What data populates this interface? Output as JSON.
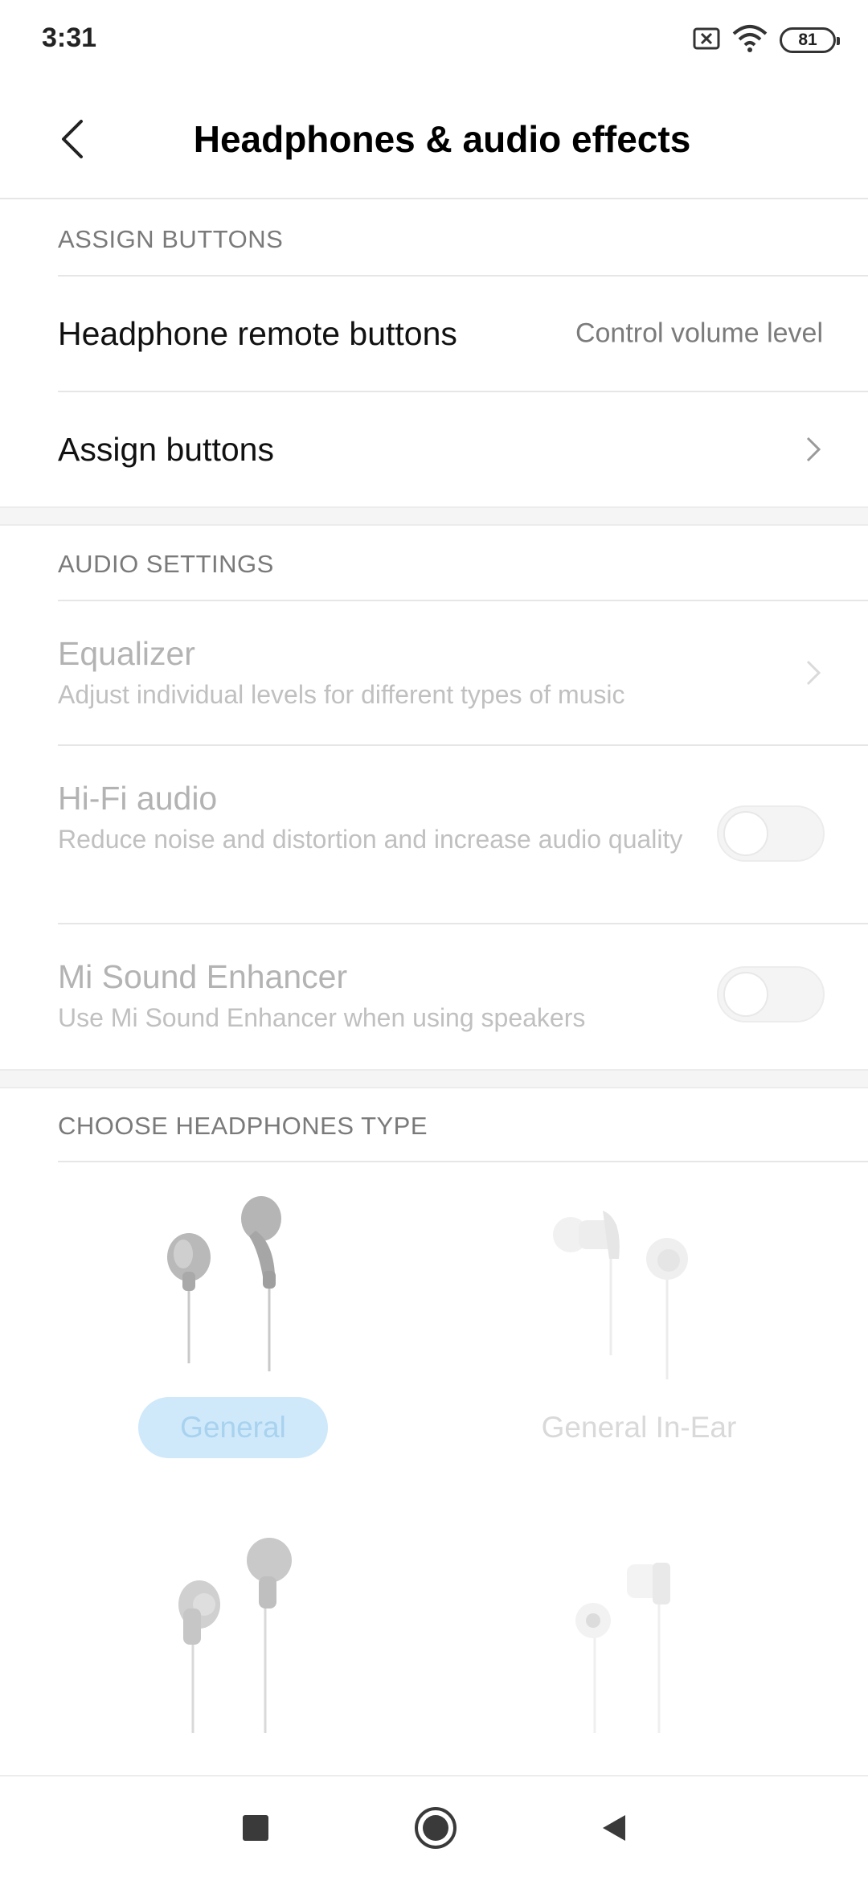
{
  "status_bar": {
    "time": "3:31",
    "battery": "81",
    "icons": [
      "sim-error-icon",
      "wifi-icon",
      "battery-icon"
    ]
  },
  "header": {
    "title": "Headphones & audio effects",
    "back_icon": "back-arrow-icon"
  },
  "assign_buttons_section": {
    "header": "ASSIGN BUTTONS",
    "items": [
      {
        "title": "Headphone remote buttons",
        "value": "Control volume level"
      },
      {
        "title": "Assign buttons",
        "icon": "chevron-right-icon"
      }
    ]
  },
  "audio_settings_section": {
    "header": "AUDIO SETTINGS",
    "items": [
      {
        "title": "Equalizer",
        "subtitle": "Adjust individual levels for different types of music",
        "enabled": false
      },
      {
        "title": "Hi-Fi audio",
        "subtitle": "Reduce noise and distortion and increase audio quality",
        "toggle": false,
        "enabled": false
      },
      {
        "title": "Mi Sound Enhancer",
        "subtitle": "Use Mi Sound Enhancer when using speakers",
        "toggle": false,
        "enabled": false
      }
    ]
  },
  "headphones_section": {
    "header": "CHOOSE HEADPHONES TYPE",
    "options": [
      {
        "label": "General",
        "selected": true
      },
      {
        "label": "General In-Ear",
        "selected": false
      }
    ]
  },
  "nav_bar": {
    "icons": [
      "recents-square-icon",
      "home-circle-icon",
      "back-triangle-icon"
    ]
  },
  "colors": {
    "selected_pill": "#cfe9fb",
    "selected_text": "#a8d2ee",
    "divider": "#e6e6e6",
    "section_gap": "#f5f5f5"
  }
}
